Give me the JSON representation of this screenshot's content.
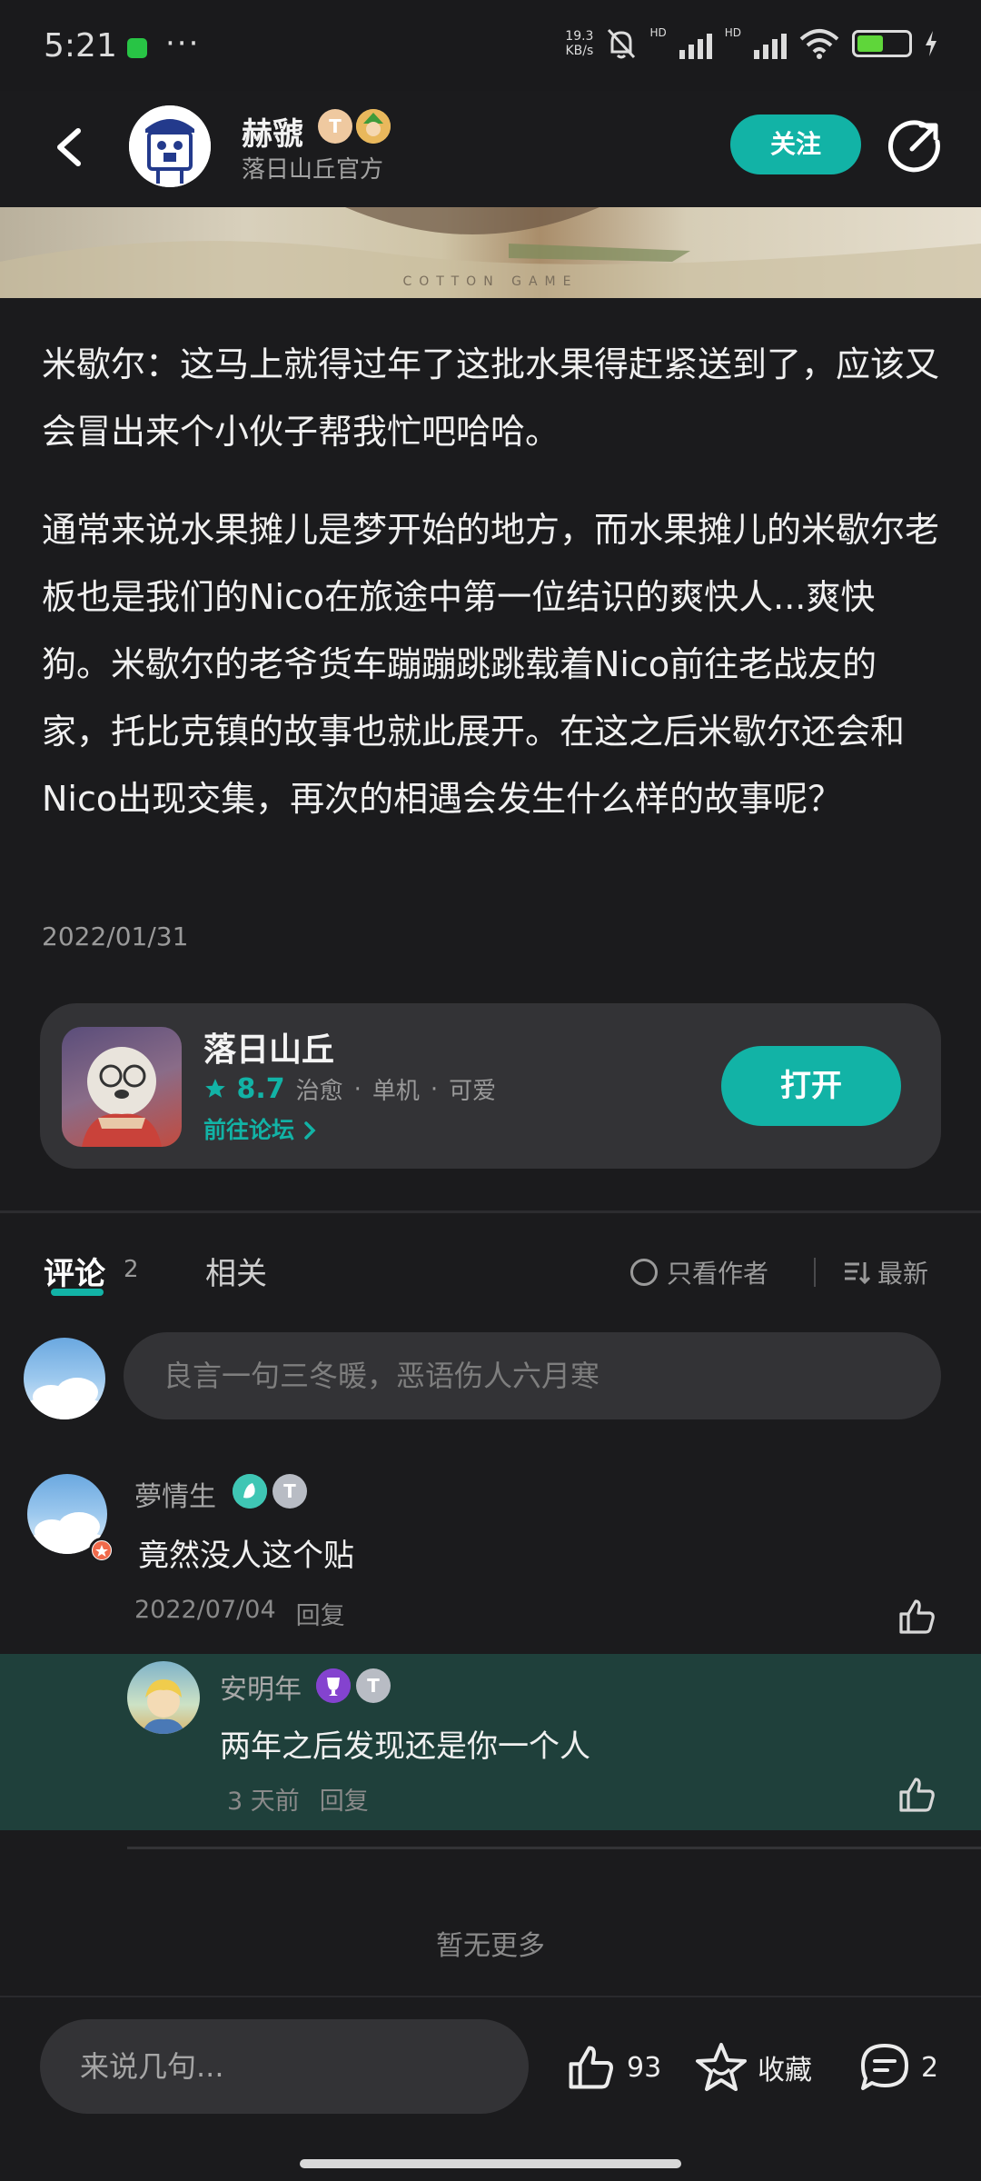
{
  "status_bar": {
    "time": "5:21",
    "net_speed_value": "19.3",
    "net_speed_unit": "KB/s",
    "hd1": "HD",
    "hd2": "HD",
    "battery_color": "#5fd63a"
  },
  "header": {
    "author_name": "赫虢",
    "author_subtitle": "落日山丘官方",
    "badge_t": "T",
    "follow_label": "关注"
  },
  "banner": {
    "watermark": "COTTON GAME"
  },
  "post": {
    "paragraph1": "米歇尔：这马上就得过年了这批水果得赶紧送到了，应该又会冒出来个小伙子帮我忙吧哈哈。",
    "paragraph2": "通常来说水果摊儿是梦开始的地方，而水果摊儿的米歇尔老板也是我们的Nico在旅途中第一位结识的爽快人...爽快狗。米歇尔的老爷货车蹦蹦跳跳载着Nico前往老战友的家，托比克镇的故事也就此展开。在这之后米歇尔还会和Nico出现交集，再次的相遇会发生什么样的故事呢？",
    "date": "2022/01/31"
  },
  "game_card": {
    "title": "落日山丘",
    "rating": "8.7",
    "tags": [
      "治愈",
      "单机",
      "可爱"
    ],
    "forum_link": "前往论坛",
    "open_label": "打开"
  },
  "tabs": {
    "comments_label": "评论",
    "comments_count": "2",
    "related_label": "相关",
    "author_only_label": "只看作者",
    "sort_label": "最新"
  },
  "comment_input": {
    "placeholder": "良言一句三冬暖，恶语伤人六月寒"
  },
  "comments": [
    {
      "name": "夢情生",
      "text": "竟然没人这个贴",
      "date": "2022/07/04",
      "reply_label": "回复"
    }
  ],
  "reply": {
    "name": "安明年",
    "text": "两年之后发现还是你一个人",
    "time": "3 天前",
    "reply_label": "回复"
  },
  "no_more": "暂无更多",
  "bottom_bar": {
    "placeholder": "来说几句...",
    "likes": "93",
    "collect_label": "收藏",
    "comments": "2"
  },
  "colors": {
    "accent": "#12b3a6",
    "background": "#1b1b1d",
    "reply_highlight": "#1f403b"
  },
  "icons": [
    "back-icon",
    "share-icon",
    "star-icon",
    "chevron-right-icon",
    "circle-icon",
    "sort-icon",
    "like-icon",
    "collect-star-icon",
    "comment-bubble-icon"
  ]
}
